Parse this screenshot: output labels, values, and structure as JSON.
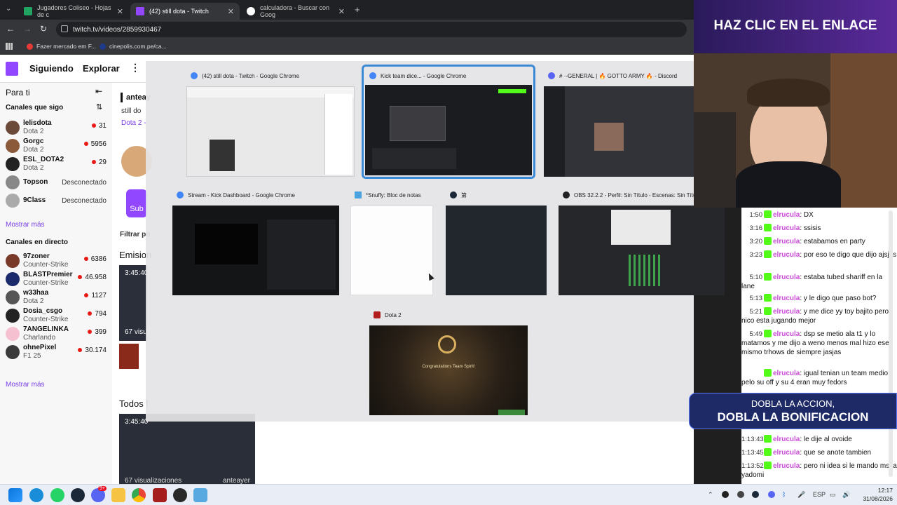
{
  "browser": {
    "tabs": [
      {
        "label": "Jugadores Coliseo - Hojas de c",
        "color": "#1ea362"
      },
      {
        "label": "(42) still dota - Twitch",
        "color": "#9146ff"
      },
      {
        "label": "calculadora - Buscar con Goog",
        "color": "#ffffff"
      }
    ],
    "url": "twitch.tv/videos/2859930467",
    "bookmarks": [
      "Fazer mercado em F...",
      "cinepolis.com.pe/ca..."
    ]
  },
  "twitch": {
    "nav": [
      "Siguiendo",
      "Explorar"
    ],
    "sidebar": {
      "for_you": "Para ti",
      "followed_title": "Canales que sigo",
      "followed": [
        {
          "name": "lelisdota",
          "game": "Dota 2",
          "viewers": "31",
          "color": "#6b4a3a"
        },
        {
          "name": "Gorgc",
          "game": "Dota 2",
          "viewers": "5956",
          "color": "#8a5a3a"
        },
        {
          "name": "ESL_DOTA2",
          "game": "Dota 2",
          "viewers": "29",
          "color": "#222222"
        },
        {
          "name": "Topson",
          "status": "Desconectado",
          "color": "#888888"
        },
        {
          "name": "9Class",
          "status": "Desconectado",
          "color": "#aaaaaa"
        }
      ],
      "show_more_1": "Mostrar más",
      "live_title": "Canales en directo",
      "live": [
        {
          "name": "97zoner",
          "game": "Counter-Strike",
          "viewers": "6386",
          "color": "#7a3a2a"
        },
        {
          "name": "BLASTPremier",
          "game": "Counter-Strike",
          "viewers": "46.958",
          "color": "#1a2a6a"
        },
        {
          "name": "w33haa",
          "game": "Dota 2",
          "viewers": "1127",
          "color": "#555555"
        },
        {
          "name": "Dosia_csgo",
          "game": "Counter-Strike",
          "viewers": "794",
          "color": "#222222"
        },
        {
          "name": "7ANGELINKA",
          "game": "Charlando",
          "viewers": "399",
          "color": "#f5c0d0"
        },
        {
          "name": "ohnePixel",
          "game": "F1 25",
          "viewers": "30.174",
          "color": "#3a3a3a"
        }
      ],
      "show_more_2": "Mostrar más"
    },
    "content": {
      "title_frag": "anteay",
      "sub_frag": "still do",
      "game_frag": "Dota 2 -",
      "sub_badge": "Sub",
      "filter_frag": "Filtrar po",
      "section1": "Emision",
      "dur1": "3:45:40",
      "views1": "67 visu",
      "section2": "Todos l",
      "dur2": "3:45:40",
      "views2": "67 visualizaciones",
      "owner2": "anteayer"
    }
  },
  "switcher": {
    "windows": [
      {
        "title": "(42) still dota - Twitch - Google Chrome"
      },
      {
        "title": "Kick team dice... - Google Chrome"
      },
      {
        "title": "# ·-GENERAL | 🔥 GOTTO ARMY 🔥 - Discord"
      },
      {
        "title": "Stream - Kick Dashboard - Google Chrome"
      },
      {
        "title": "*Snuffy: Bloc de notas"
      },
      {
        "title": "第"
      },
      {
        "title": "OBS 32.2.2 - Perfil: Sin Título - Escenas: Sin Títu"
      },
      {
        "title": "Dota 2"
      }
    ],
    "dota_text": "Congratulations Team Spirit!"
  },
  "overlay": {
    "banner": "HAZ CLIC EN EL ENLACE",
    "promo_line1": "DOBLA LA ACCION,",
    "promo_line2": "DOBLA LA BONIFICACION"
  },
  "chat": {
    "messages": [
      {
        "ts": "1:50",
        "user": "elrucula",
        "text": "DX"
      },
      {
        "ts": "3:16",
        "user": "elrucula",
        "text": "ssisis"
      },
      {
        "ts": "3:20",
        "user": "elrucula",
        "text": "estabamos en party"
      },
      {
        "ts": "3:23",
        "user": "elrucula",
        "text": "por eso te digo que dijo ajsjas"
      },
      {
        "ts": "5:10",
        "user": "elrucula",
        "text": "estaba tubed shariff en la lane"
      },
      {
        "ts": "5:13",
        "user": "elrucula",
        "text": "y le digo que paso bot?"
      },
      {
        "ts": "5:21",
        "user": "elrucula",
        "text": "y me dice yy toy bajito pero nico esta jugando mejor"
      },
      {
        "ts": "5:49",
        "user": "elrucula",
        "text": "dsp se metio ala t1 y lo matamos y me dijo a weno menos mal hizo ese mismo trhows de siempre jasjas"
      },
      {
        "ts": "",
        "user": "elrucula",
        "text": "igual tenian un team medio pelo su off y su 4 eran muy fedors"
      },
      {
        "ts": "1:13:43",
        "user": "elrucula",
        "text": "le dije al ovoide"
      },
      {
        "ts": "1:13:45",
        "user": "elrucula",
        "text": "que se anote tambien"
      },
      {
        "ts": "1:13:52",
        "user": "elrucula",
        "text": "pero ni idea si le mando msj a yadomi"
      }
    ]
  },
  "taskbar": {
    "lang": "ESP",
    "time": "12:17",
    "date": "31/08/2026",
    "badge": "9+"
  }
}
